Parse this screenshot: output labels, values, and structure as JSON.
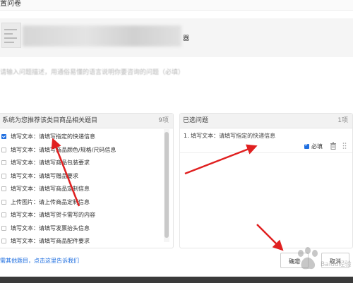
{
  "header": {
    "title": "置问卷"
  },
  "product": {
    "name_suffix": "器"
  },
  "description": {
    "placeholder": "请输入问题描述，用通俗易懂的语言说明你要咨询的问题（必填）"
  },
  "left_panel": {
    "title": "系统为您推荐该类目商品相关题目",
    "count": "9项",
    "options": [
      {
        "label": "填写文本：请填写指定的快递信息",
        "checked": true
      },
      {
        "label": "填写文本：请填写商品颜色/规格/尺码信息",
        "checked": false
      },
      {
        "label": "填写文本：请填写商品包装要求",
        "checked": false
      },
      {
        "label": "填写文本：请填写赠品要求",
        "checked": false
      },
      {
        "label": "填写文本：请填写商品定制信息",
        "checked": false
      },
      {
        "label": "上传图片：请上传商品定制信息",
        "checked": false
      },
      {
        "label": "填写文本：请填写贺卡需写的内容",
        "checked": false
      },
      {
        "label": "填写文本：请填写发票抬头信息",
        "checked": false
      },
      {
        "label": "填写文本：请填写商品配件要求",
        "checked": false
      }
    ]
  },
  "right_panel": {
    "title": "已选问题",
    "count": "1项",
    "item": "1. 填写文本：请填写指定的快递信息",
    "required_label": "必填"
  },
  "footer": {
    "feedback_link": "需其他题目，点击这里告诉我们",
    "ok_label": "确定",
    "cancel_label": "取消"
  },
  "watermark": {
    "text": "Baidu经验"
  },
  "colors": {
    "accent": "#1e6ee0",
    "annotation_arrow": "#e02020"
  }
}
